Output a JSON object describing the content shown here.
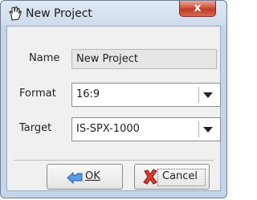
{
  "window": {
    "title": "New Project",
    "app_icon": "hand-cursor-icon",
    "close_icon": "close-icon",
    "close_label": "x"
  },
  "form": {
    "name_label": "Name",
    "name_value": "New Project",
    "format_label": "Format",
    "format_value": "16:9",
    "target_label": "Target",
    "target_value": "IS-SPX-1000"
  },
  "buttons": {
    "ok_label": "OK",
    "ok_icon": "back-arrow-icon",
    "cancel_label": "Cancel",
    "cancel_icon": "red-x-icon"
  },
  "colors": {
    "close_button": "#c23a25",
    "ok_icon": "#3b7ddd",
    "cancel_icon": "#d81e1e"
  }
}
